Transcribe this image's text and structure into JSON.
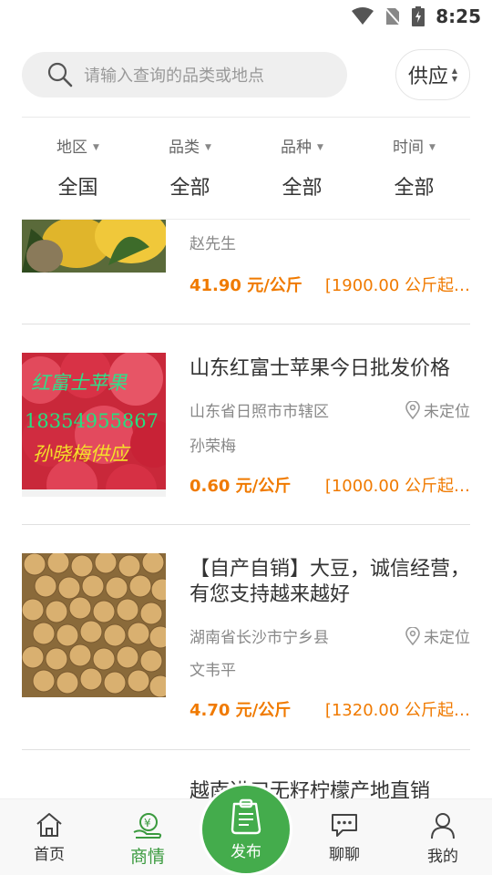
{
  "status_bar": {
    "time": "8:25"
  },
  "search": {
    "placeholder": "请输入查询的品类或地点"
  },
  "supply_toggle": {
    "label": "供应"
  },
  "filters": [
    {
      "label": "地区",
      "value": "全国"
    },
    {
      "label": "品类",
      "value": "全部"
    },
    {
      "label": "品种",
      "value": "全部"
    },
    {
      "label": "时间",
      "value": "全部"
    }
  ],
  "listings": [
    {
      "title": "",
      "seller": "赵先生",
      "price": "41.90 元/公斤",
      "minimum": "[1900.00 公斤起…"
    },
    {
      "title": "山东红富士苹果今日批发价格",
      "region": "山东省日照市市辖区",
      "locate": "未定位",
      "seller": "孙荣梅",
      "price": "0.60 元/公斤",
      "minimum": "[1000.00 公斤起…",
      "image_text": {
        "line1": "红富士苹果",
        "line2": "18354955867",
        "line3": "孙晓梅供应"
      }
    },
    {
      "title": "【自产自销】大豆，诚信经营，有您支持越来越好",
      "region": "湖南省长沙市宁乡县",
      "locate": "未定位",
      "seller": "文韦平",
      "price": "4.70 元/公斤",
      "minimum": "[1320.00 公斤起…"
    },
    {
      "title": "越南进口无籽柠檬产地直销"
    }
  ],
  "tabbar": {
    "home": "首页",
    "market": "商情",
    "publish": "发布",
    "chat": "聊聊",
    "mine": "我的"
  },
  "colors": {
    "accent": "#44ac4c",
    "price": "#f07a00"
  }
}
